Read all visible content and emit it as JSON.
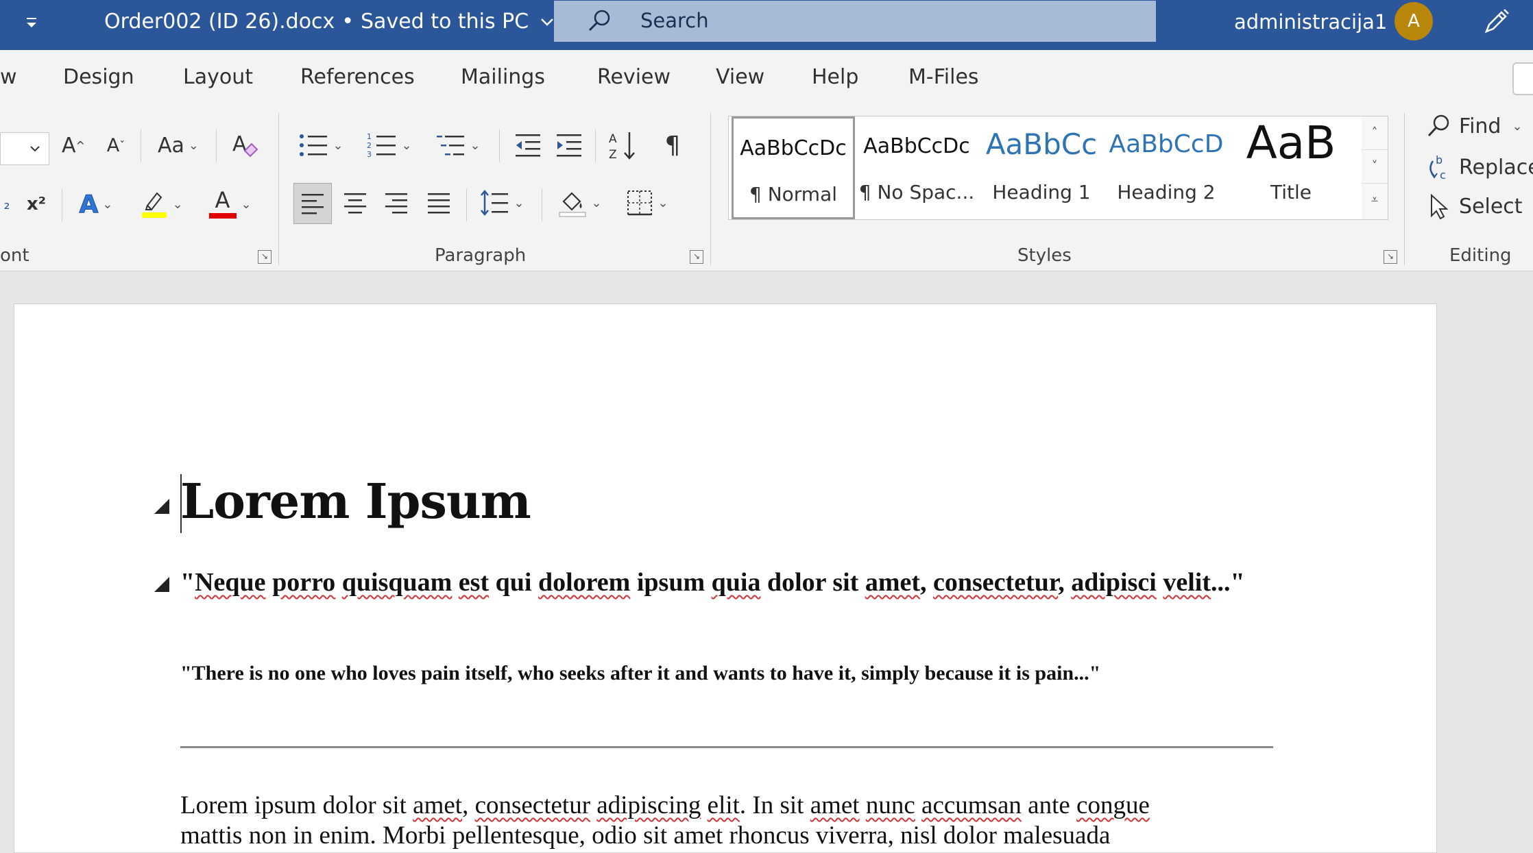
{
  "titlebar": {
    "doc_title": "Order002 (ID 26).docx",
    "bullet": "•",
    "save_status": "Saved to this PC",
    "search_placeholder": "Search",
    "username": "administracija1",
    "avatar_initial": "A",
    "bg_color": "#2b579a"
  },
  "tabs": [
    "w",
    "Design",
    "Layout",
    "References",
    "Mailings",
    "Review",
    "View",
    "Help",
    "M-Files"
  ],
  "ribbon": {
    "font": {
      "label": "ont",
      "grow": "A",
      "shrink": "A",
      "change_case": "Aa",
      "superscript": "x²",
      "text_effects": "A",
      "font_color": "A"
    },
    "paragraph": {
      "label": "Paragraph",
      "pilcrow": "¶"
    },
    "styles": {
      "label": "Styles",
      "items": [
        {
          "sample": "AaBbCcDc",
          "name": "¶ Normal"
        },
        {
          "sample": "AaBbCcDc",
          "name": "¶ No Spac..."
        },
        {
          "sample": "AaBbCc",
          "name": "Heading 1"
        },
        {
          "sample": "AaBbCcD",
          "name": "Heading 2"
        },
        {
          "sample": "AaB",
          "name": "Title"
        }
      ]
    },
    "editing": {
      "label": "Editing",
      "find": "Find",
      "replace": "Replace",
      "select": "Select"
    }
  },
  "document": {
    "heading": "Lorem Ipsum",
    "quote1_words": [
      "\"",
      "Neque",
      " ",
      "porro",
      " ",
      "quisquam",
      " ",
      "est",
      " qui ",
      "dolorem",
      " ipsum ",
      "quia",
      " dolor sit ",
      "amet",
      ", ",
      "consectetur",
      ", ",
      "adipisci",
      " ",
      "velit",
      "...\""
    ],
    "quote2": "\"There is no one who loves pain itself, who seeks after it and wants to have it, simply because it is pain...\"",
    "body_line1_words": [
      "Lorem ipsum dolor sit ",
      "amet",
      ", ",
      "consectetur",
      " ",
      "adipiscing",
      " ",
      "elit",
      ". In sit ",
      "amet",
      " ",
      "nunc",
      " ",
      "accumsan",
      " ante ",
      "congue"
    ],
    "body_line2": "mattis non in enim. Morbi pellentesque, odio sit amet rhoncus viverra, nisl dolor malesuada"
  }
}
